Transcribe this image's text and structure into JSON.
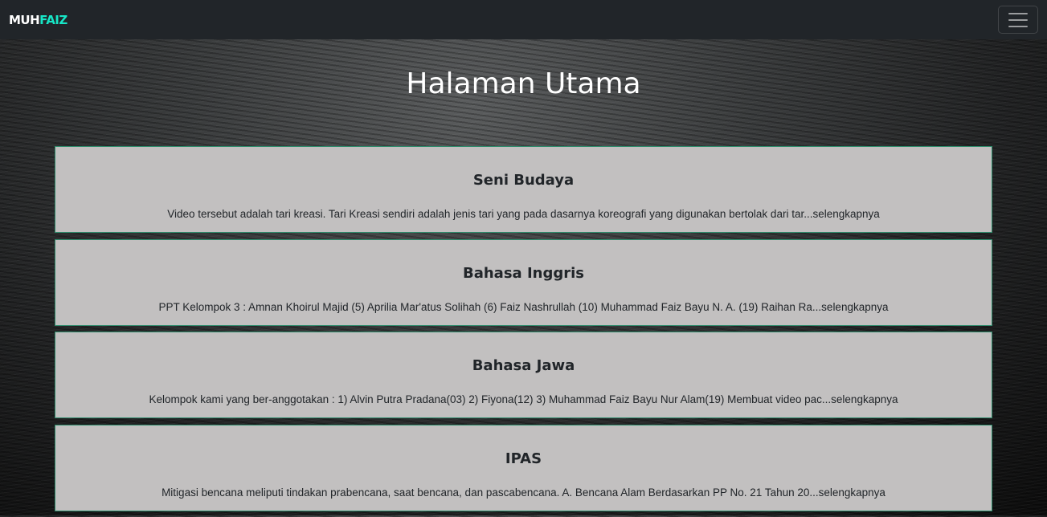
{
  "navbar": {
    "brand_first": "MUH",
    "brand_second": "FAIZ",
    "toggler_icon": "hamburger-menu-icon"
  },
  "main": {
    "title": "Halaman Utama",
    "cards": [
      {
        "title": "Seni Budaya",
        "excerpt": "Video tersebut adalah tari kreasi. Tari Kreasi sendiri adalah jenis tari yang pada dasarnya koreografi yang digunakan bertolak dari tar...selengkapnya"
      },
      {
        "title": "Bahasa Inggris",
        "excerpt": "PPT Kelompok 3 : Amnan Khoirul Majid (5) Aprilia Mar'atus Solihah (6) Faiz Nashrullah (10) Muhammad Faiz Bayu N. A. (19) Raihan Ra...selengkapnya"
      },
      {
        "title": "Bahasa Jawa",
        "excerpt": "Kelompok kami yang ber-anggotakan : 1) Alvin Putra Pradana(03) 2) Fiyona(12) 3) Muhammad Faiz Bayu Nur Alam(19) Membuat video pac...selengkapnya"
      },
      {
        "title": "IPAS",
        "excerpt": "Mitigasi bencana meliputi tindakan prabencana, saat bencana, dan pascabencana. A. Bencana Alam Berdasarkan PP No. 21 Tahun 20...selengkapnya"
      }
    ]
  },
  "colors": {
    "navbar_bg": "#212529",
    "brand_accent": "#17e6c6",
    "card_bg": "#c2c0c0",
    "card_border": "#2e8b6b"
  }
}
